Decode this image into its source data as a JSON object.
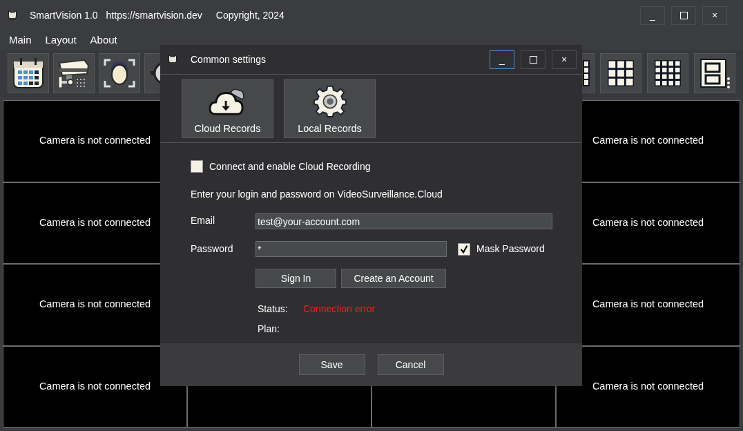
{
  "window": {
    "title": "SmartVision 1.0",
    "url": "https://smartvision.dev",
    "copyright": "Copyright, 2024",
    "controls": [
      {
        "kind": "minimize",
        "label": "_",
        "focused": false
      },
      {
        "kind": "maximize",
        "focused": false
      },
      {
        "kind": "close",
        "label": "×",
        "focused": false
      }
    ]
  },
  "menu": [
    "Main",
    "Layout",
    "About"
  ],
  "camera_grid": {
    "cells": [
      "Camera is not connected",
      null,
      null,
      "Camera is not connected",
      "Camera is not connected",
      null,
      null,
      "Camera is not connected",
      "Camera is not connected",
      null,
      null,
      "Camera is not connected",
      "Camera is not connected",
      null,
      null,
      "Camera is not connected"
    ]
  },
  "dialog": {
    "title": "Common settings",
    "controls": [
      {
        "kind": "minimize",
        "label": "_",
        "focused": true
      },
      {
        "kind": "maximize",
        "focused": false
      },
      {
        "kind": "close",
        "label": "×",
        "focused": false
      }
    ],
    "tabs": [
      {
        "kind": "cloud",
        "label": "Cloud Records"
      },
      {
        "kind": "gear",
        "label": "Local Records"
      }
    ],
    "enable_checkbox": {
      "label": "Connect and enable Cloud Recording",
      "checked": false
    },
    "instructions": "Enter your login and password on VideoSurveillance.Cloud",
    "email": {
      "label": "Email",
      "value": "test@your-account.com"
    },
    "password": {
      "label": "Password",
      "value": "*"
    },
    "mask_checkbox": {
      "label": "Mask Password",
      "checked": true
    },
    "buttons": [
      "Sign In",
      "Create an Account"
    ],
    "status": {
      "label": "Status:",
      "value": "Connection error"
    },
    "plan": {
      "label": "Plan:"
    },
    "footer_buttons": [
      "Save",
      "Cancel"
    ]
  }
}
